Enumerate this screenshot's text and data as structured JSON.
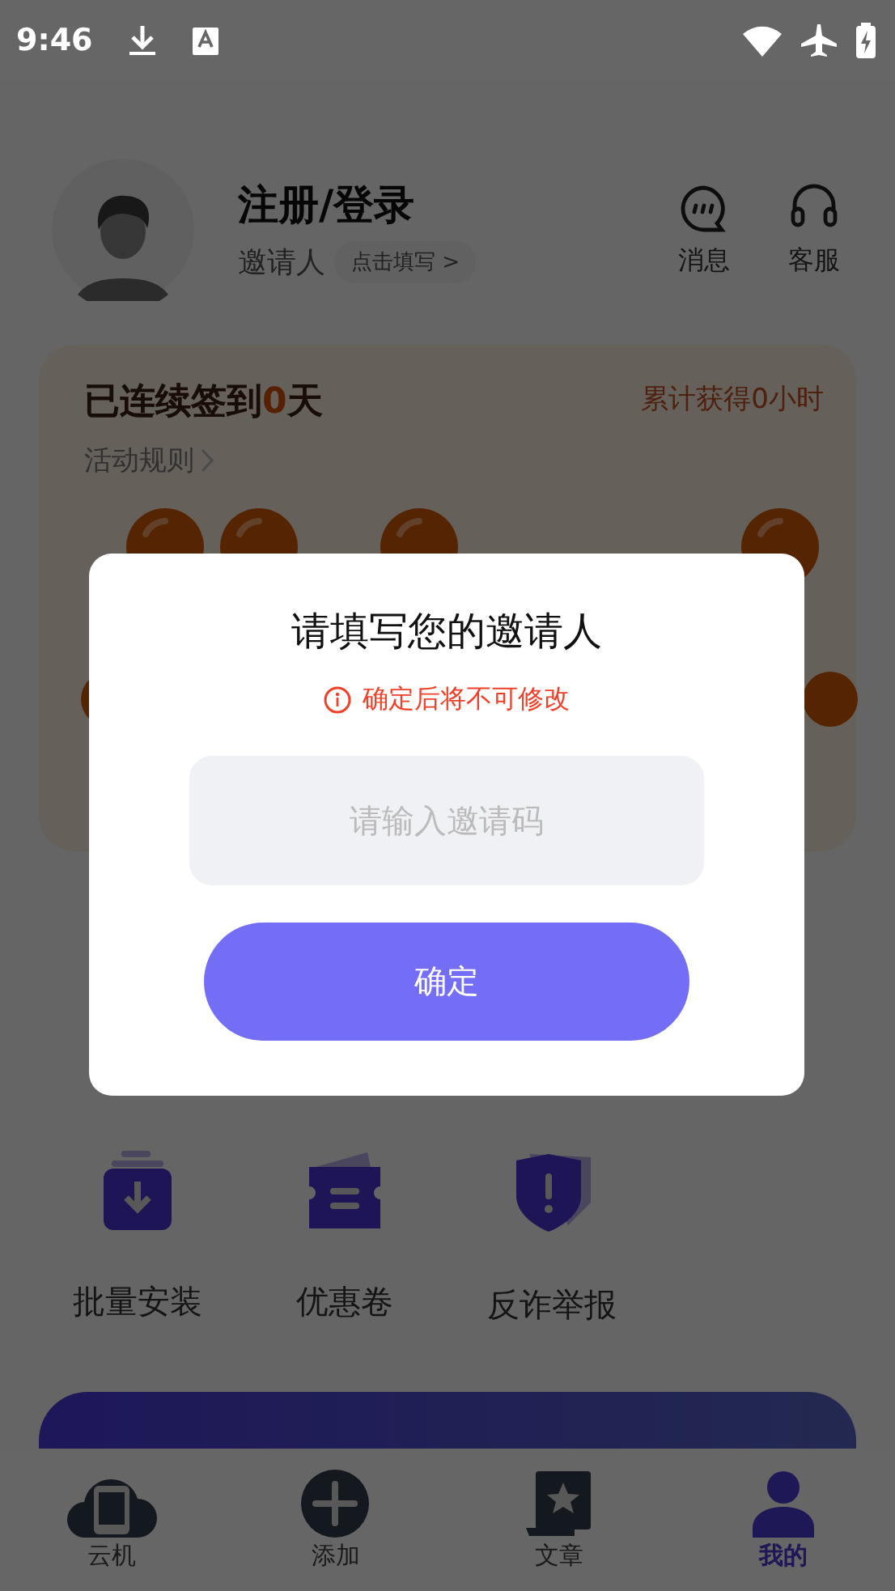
{
  "status_bar": {
    "time": "9:46"
  },
  "profile": {
    "name": "注册/登录",
    "inviter_label": "邀请人",
    "inviter_action": "点击填写 >",
    "actions": [
      {
        "label": "消息",
        "kind": "message"
      },
      {
        "label": "客服",
        "kind": "support"
      }
    ]
  },
  "checkin": {
    "title_prefix": "已连续签到",
    "streak": "0",
    "title_suffix": "天",
    "total": "累计获得0小时",
    "rules": "活动规则"
  },
  "tools": [
    {
      "label": "批量安装",
      "kind": "install"
    },
    {
      "label": "优惠卷",
      "kind": "coupon"
    },
    {
      "label": "反诈举报",
      "kind": "report"
    }
  ],
  "dialog": {
    "title": "请填写您的邀请人",
    "warning": "确定后将不可修改",
    "input": {
      "placeholder": "请输入邀请码"
    },
    "confirm": "确定"
  },
  "tabs": [
    {
      "label": "云机",
      "kind": "cloud",
      "selected": false
    },
    {
      "label": "添加",
      "kind": "add",
      "selected": false
    },
    {
      "label": "文章",
      "kind": "article",
      "selected": false
    },
    {
      "label": "我的",
      "kind": "me",
      "selected": true
    }
  ]
}
